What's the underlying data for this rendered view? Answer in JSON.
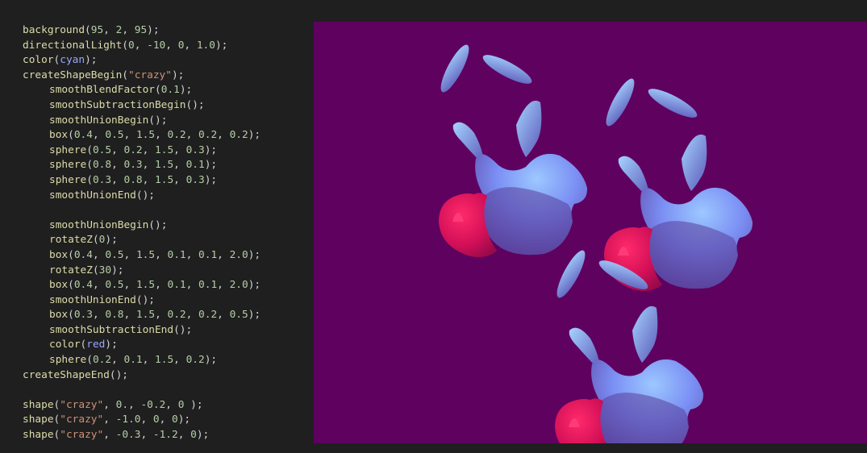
{
  "editor": {
    "lines": [
      {
        "indent": 0,
        "tokens": [
          {
            "t": "fn",
            "v": "background"
          },
          {
            "t": "punc",
            "v": "("
          },
          {
            "t": "num",
            "v": "95"
          },
          {
            "t": "punc",
            "v": ", "
          },
          {
            "t": "num",
            "v": "2"
          },
          {
            "t": "punc",
            "v": ", "
          },
          {
            "t": "num",
            "v": "95"
          },
          {
            "t": "punc",
            "v": ");"
          }
        ]
      },
      {
        "indent": 0,
        "tokens": [
          {
            "t": "fn",
            "v": "directionalLight"
          },
          {
            "t": "punc",
            "v": "("
          },
          {
            "t": "num",
            "v": "0"
          },
          {
            "t": "punc",
            "v": ", "
          },
          {
            "t": "num",
            "v": "-10"
          },
          {
            "t": "punc",
            "v": ", "
          },
          {
            "t": "num",
            "v": "0"
          },
          {
            "t": "punc",
            "v": ", "
          },
          {
            "t": "num",
            "v": "1.0"
          },
          {
            "t": "punc",
            "v": ");"
          }
        ]
      },
      {
        "indent": 0,
        "tokens": [
          {
            "t": "fn",
            "v": "color"
          },
          {
            "t": "punc",
            "v": "("
          },
          {
            "t": "const",
            "v": "cyan"
          },
          {
            "t": "punc",
            "v": ");"
          }
        ]
      },
      {
        "indent": 0,
        "tokens": [
          {
            "t": "fn",
            "v": "createShapeBegin"
          },
          {
            "t": "punc",
            "v": "("
          },
          {
            "t": "str",
            "v": "\"crazy\""
          },
          {
            "t": "punc",
            "v": ");"
          }
        ]
      },
      {
        "indent": 1,
        "tokens": [
          {
            "t": "fn",
            "v": "smoothBlendFactor"
          },
          {
            "t": "punc",
            "v": "("
          },
          {
            "t": "num",
            "v": "0.1"
          },
          {
            "t": "punc",
            "v": ");"
          }
        ]
      },
      {
        "indent": 1,
        "tokens": [
          {
            "t": "fn",
            "v": "smoothSubtractionBegin"
          },
          {
            "t": "punc",
            "v": "();"
          }
        ]
      },
      {
        "indent": 1,
        "tokens": [
          {
            "t": "fn",
            "v": "smoothUnionBegin"
          },
          {
            "t": "punc",
            "v": "();"
          }
        ]
      },
      {
        "indent": 1,
        "tokens": [
          {
            "t": "fn",
            "v": "box"
          },
          {
            "t": "punc",
            "v": "("
          },
          {
            "t": "num",
            "v": "0.4"
          },
          {
            "t": "punc",
            "v": ", "
          },
          {
            "t": "num",
            "v": "0.5"
          },
          {
            "t": "punc",
            "v": ", "
          },
          {
            "t": "num",
            "v": "1.5"
          },
          {
            "t": "punc",
            "v": ", "
          },
          {
            "t": "num",
            "v": "0.2"
          },
          {
            "t": "punc",
            "v": ", "
          },
          {
            "t": "num",
            "v": "0.2"
          },
          {
            "t": "punc",
            "v": ", "
          },
          {
            "t": "num",
            "v": "0.2"
          },
          {
            "t": "punc",
            "v": ");"
          }
        ]
      },
      {
        "indent": 1,
        "tokens": [
          {
            "t": "fn",
            "v": "sphere"
          },
          {
            "t": "punc",
            "v": "("
          },
          {
            "t": "num",
            "v": "0.5"
          },
          {
            "t": "punc",
            "v": ", "
          },
          {
            "t": "num",
            "v": "0.2"
          },
          {
            "t": "punc",
            "v": ", "
          },
          {
            "t": "num",
            "v": "1.5"
          },
          {
            "t": "punc",
            "v": ", "
          },
          {
            "t": "num",
            "v": "0.3"
          },
          {
            "t": "punc",
            "v": ");"
          }
        ]
      },
      {
        "indent": 1,
        "tokens": [
          {
            "t": "fn",
            "v": "sphere"
          },
          {
            "t": "punc",
            "v": "("
          },
          {
            "t": "num",
            "v": "0.8"
          },
          {
            "t": "punc",
            "v": ", "
          },
          {
            "t": "num",
            "v": "0.3"
          },
          {
            "t": "punc",
            "v": ", "
          },
          {
            "t": "num",
            "v": "1.5"
          },
          {
            "t": "punc",
            "v": ", "
          },
          {
            "t": "num",
            "v": "0.1"
          },
          {
            "t": "punc",
            "v": ");"
          }
        ]
      },
      {
        "indent": 1,
        "tokens": [
          {
            "t": "fn",
            "v": "sphere"
          },
          {
            "t": "punc",
            "v": "("
          },
          {
            "t": "num",
            "v": "0.3"
          },
          {
            "t": "punc",
            "v": ", "
          },
          {
            "t": "num",
            "v": "0.8"
          },
          {
            "t": "punc",
            "v": ", "
          },
          {
            "t": "num",
            "v": "1.5"
          },
          {
            "t": "punc",
            "v": ", "
          },
          {
            "t": "num",
            "v": "0.3"
          },
          {
            "t": "punc",
            "v": ");"
          }
        ]
      },
      {
        "indent": 1,
        "tokens": [
          {
            "t": "fn",
            "v": "smoothUnionEnd"
          },
          {
            "t": "punc",
            "v": "();"
          }
        ]
      },
      {
        "indent": 0,
        "tokens": []
      },
      {
        "indent": 1,
        "tokens": [
          {
            "t": "fn",
            "v": "smoothUnionBegin"
          },
          {
            "t": "punc",
            "v": "();"
          }
        ]
      },
      {
        "indent": 1,
        "tokens": [
          {
            "t": "fn",
            "v": "rotateZ"
          },
          {
            "t": "punc",
            "v": "("
          },
          {
            "t": "num",
            "v": "0"
          },
          {
            "t": "punc",
            "v": ");"
          }
        ]
      },
      {
        "indent": 1,
        "tokens": [
          {
            "t": "fn",
            "v": "box"
          },
          {
            "t": "punc",
            "v": "("
          },
          {
            "t": "num",
            "v": "0.4"
          },
          {
            "t": "punc",
            "v": ", "
          },
          {
            "t": "num",
            "v": "0.5"
          },
          {
            "t": "punc",
            "v": ", "
          },
          {
            "t": "num",
            "v": "1.5"
          },
          {
            "t": "punc",
            "v": ", "
          },
          {
            "t": "num",
            "v": "0.1"
          },
          {
            "t": "punc",
            "v": ", "
          },
          {
            "t": "num",
            "v": "0.1"
          },
          {
            "t": "punc",
            "v": ", "
          },
          {
            "t": "num",
            "v": "2.0"
          },
          {
            "t": "punc",
            "v": ");"
          }
        ]
      },
      {
        "indent": 1,
        "tokens": [
          {
            "t": "fn",
            "v": "rotateZ"
          },
          {
            "t": "punc",
            "v": "("
          },
          {
            "t": "num",
            "v": "30"
          },
          {
            "t": "punc",
            "v": ");"
          }
        ]
      },
      {
        "indent": 1,
        "tokens": [
          {
            "t": "fn",
            "v": "box"
          },
          {
            "t": "punc",
            "v": "("
          },
          {
            "t": "num",
            "v": "0.4"
          },
          {
            "t": "punc",
            "v": ", "
          },
          {
            "t": "num",
            "v": "0.5"
          },
          {
            "t": "punc",
            "v": ", "
          },
          {
            "t": "num",
            "v": "1.5"
          },
          {
            "t": "punc",
            "v": ", "
          },
          {
            "t": "num",
            "v": "0.1"
          },
          {
            "t": "punc",
            "v": ", "
          },
          {
            "t": "num",
            "v": "0.1"
          },
          {
            "t": "punc",
            "v": ", "
          },
          {
            "t": "num",
            "v": "2.0"
          },
          {
            "t": "punc",
            "v": ");"
          }
        ]
      },
      {
        "indent": 1,
        "tokens": [
          {
            "t": "fn",
            "v": "smoothUnionEnd"
          },
          {
            "t": "punc",
            "v": "();"
          }
        ]
      },
      {
        "indent": 1,
        "tokens": [
          {
            "t": "fn",
            "v": "box"
          },
          {
            "t": "punc",
            "v": "("
          },
          {
            "t": "num",
            "v": "0.3"
          },
          {
            "t": "punc",
            "v": ", "
          },
          {
            "t": "num",
            "v": "0.8"
          },
          {
            "t": "punc",
            "v": ", "
          },
          {
            "t": "num",
            "v": "1.5"
          },
          {
            "t": "punc",
            "v": ", "
          },
          {
            "t": "num",
            "v": "0.2"
          },
          {
            "t": "punc",
            "v": ", "
          },
          {
            "t": "num",
            "v": "0.2"
          },
          {
            "t": "punc",
            "v": ", "
          },
          {
            "t": "num",
            "v": "0.5"
          },
          {
            "t": "punc",
            "v": ");"
          }
        ]
      },
      {
        "indent": 1,
        "tokens": [
          {
            "t": "fn",
            "v": "smoothSubtractionEnd"
          },
          {
            "t": "punc",
            "v": "();"
          }
        ]
      },
      {
        "indent": 1,
        "tokens": [
          {
            "t": "fn",
            "v": "color"
          },
          {
            "t": "punc",
            "v": "("
          },
          {
            "t": "const",
            "v": "red"
          },
          {
            "t": "punc",
            "v": ");"
          }
        ]
      },
      {
        "indent": 1,
        "tokens": [
          {
            "t": "fn",
            "v": "sphere"
          },
          {
            "t": "punc",
            "v": "("
          },
          {
            "t": "num",
            "v": "0.2"
          },
          {
            "t": "punc",
            "v": ", "
          },
          {
            "t": "num",
            "v": "0.1"
          },
          {
            "t": "punc",
            "v": ", "
          },
          {
            "t": "num",
            "v": "1.5"
          },
          {
            "t": "punc",
            "v": ", "
          },
          {
            "t": "num",
            "v": "0.2"
          },
          {
            "t": "punc",
            "v": ");"
          }
        ]
      },
      {
        "indent": 0,
        "tokens": [
          {
            "t": "fn",
            "v": "createShapeEnd"
          },
          {
            "t": "punc",
            "v": "();"
          }
        ]
      },
      {
        "indent": 0,
        "tokens": []
      },
      {
        "indent": 0,
        "tokens": [
          {
            "t": "fn",
            "v": "shape"
          },
          {
            "t": "punc",
            "v": "("
          },
          {
            "t": "str",
            "v": "\"crazy\""
          },
          {
            "t": "punc",
            "v": ", "
          },
          {
            "t": "num",
            "v": "0."
          },
          {
            "t": "punc",
            "v": ", "
          },
          {
            "t": "num",
            "v": "-0.2"
          },
          {
            "t": "punc",
            "v": ", "
          },
          {
            "t": "num",
            "v": "0"
          },
          {
            "t": "punc",
            "v": " );"
          }
        ]
      },
      {
        "indent": 0,
        "tokens": [
          {
            "t": "fn",
            "v": "shape"
          },
          {
            "t": "punc",
            "v": "("
          },
          {
            "t": "str",
            "v": "\"crazy\""
          },
          {
            "t": "punc",
            "v": ", "
          },
          {
            "t": "num",
            "v": "-1.0"
          },
          {
            "t": "punc",
            "v": ", "
          },
          {
            "t": "num",
            "v": "0"
          },
          {
            "t": "punc",
            "v": ", "
          },
          {
            "t": "num",
            "v": "0"
          },
          {
            "t": "punc",
            "v": ");"
          }
        ]
      },
      {
        "indent": 0,
        "tokens": [
          {
            "t": "fn",
            "v": "shape"
          },
          {
            "t": "punc",
            "v": "("
          },
          {
            "t": "str",
            "v": "\"crazy\""
          },
          {
            "t": "punc",
            "v": ", "
          },
          {
            "t": "num",
            "v": "-0.3"
          },
          {
            "t": "punc",
            "v": ", "
          },
          {
            "t": "num",
            "v": "-1.2"
          },
          {
            "t": "punc",
            "v": ", "
          },
          {
            "t": "num",
            "v": "0"
          },
          {
            "t": "punc",
            "v": ");"
          }
        ]
      }
    ]
  },
  "render": {
    "background_color": "#5f025f",
    "body_color": "#6f7cf0",
    "sphere_color": "#e0145a",
    "shape_count": 3
  }
}
